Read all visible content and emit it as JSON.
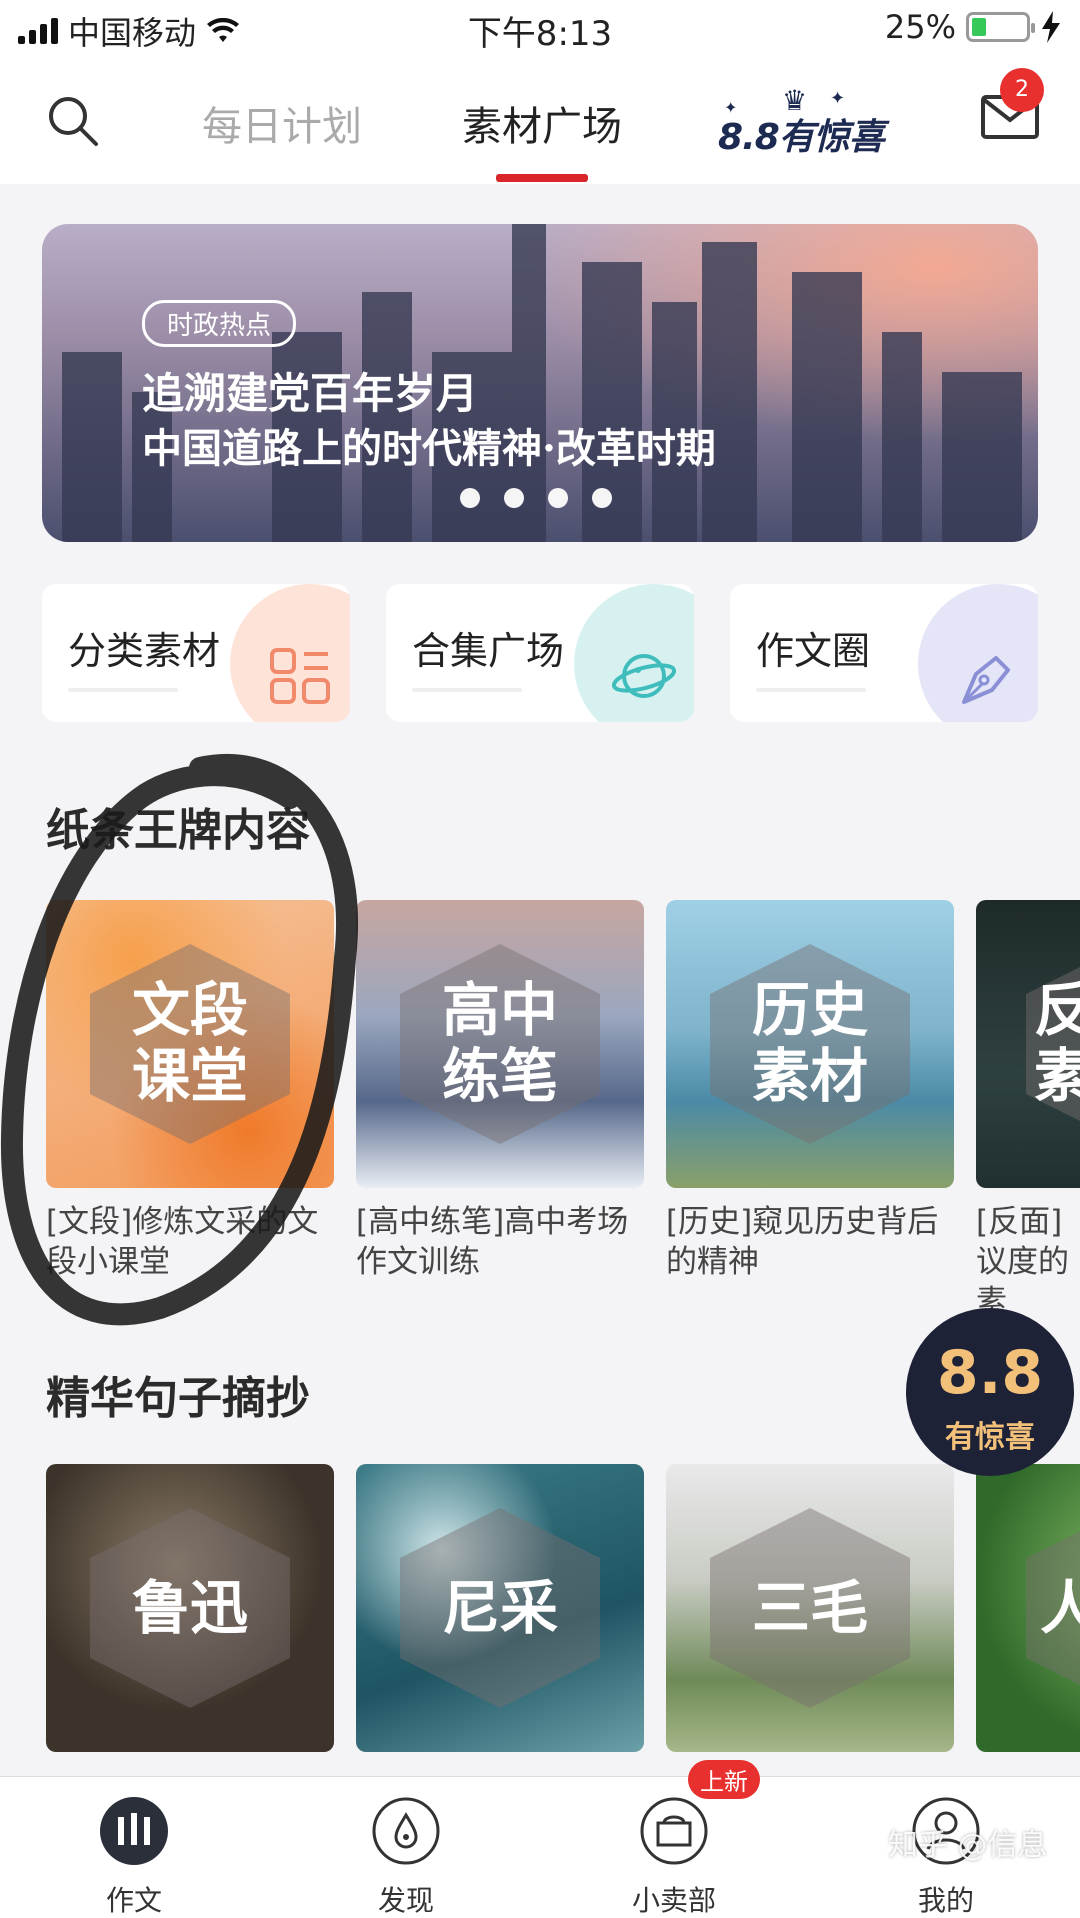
{
  "status_bar": {
    "carrier": "中国移动",
    "time": "下午8:13",
    "battery": "25%",
    "battery_level": 0.25
  },
  "top_nav": {
    "tabs": [
      {
        "label": "每日计划",
        "active": false
      },
      {
        "label": "素材广场",
        "active": true
      }
    ],
    "promo_logo_text": "8.8有惊喜",
    "mail_badge": "2"
  },
  "banner": {
    "tag": "时政热点",
    "line1": "追溯建党百年岁月",
    "line2": "中国道路上的时代精神·改革时期",
    "dot_count": 4
  },
  "shortcuts": [
    {
      "label": "分类素材",
      "icon": "grid-list-icon",
      "color": "#f08a6a"
    },
    {
      "label": "合集广场",
      "icon": "planet-icon",
      "color": "#3fbdbd"
    },
    {
      "label": "作文圈",
      "icon": "pen-nib-icon",
      "color": "#8a8fd6"
    }
  ],
  "section1": {
    "title": "纸条王牌内容",
    "cards": [
      {
        "hex_line1": "文段",
        "hex_line2": "课堂",
        "caption": "[文段]修炼文采的文段小课堂"
      },
      {
        "hex_line1": "高中",
        "hex_line2": "练笔",
        "caption": "[高中练笔]高中考场作文训练"
      },
      {
        "hex_line1": "历史",
        "hex_line2": "素材",
        "caption": "[历史]窥见历史背后的精神"
      },
      {
        "hex_line1": "反",
        "hex_line2": "素",
        "caption": "[反面]议度的素"
      }
    ]
  },
  "section2": {
    "title": "精华句子摘抄",
    "cards": [
      {
        "hex_text": "鲁迅"
      },
      {
        "hex_text": "尼采"
      },
      {
        "hex_text": "三毛"
      },
      {
        "hex_text": "人"
      }
    ]
  },
  "float_promo": {
    "number": "8.8",
    "subtitle": "有惊喜"
  },
  "tab_bar": {
    "items": [
      {
        "label": "作文",
        "active": true
      },
      {
        "label": "发现",
        "active": false
      },
      {
        "label": "小卖部",
        "active": false
      },
      {
        "label": "我的",
        "active": false
      }
    ],
    "new_badge": "上新"
  },
  "watermark": "知乎 @信息"
}
